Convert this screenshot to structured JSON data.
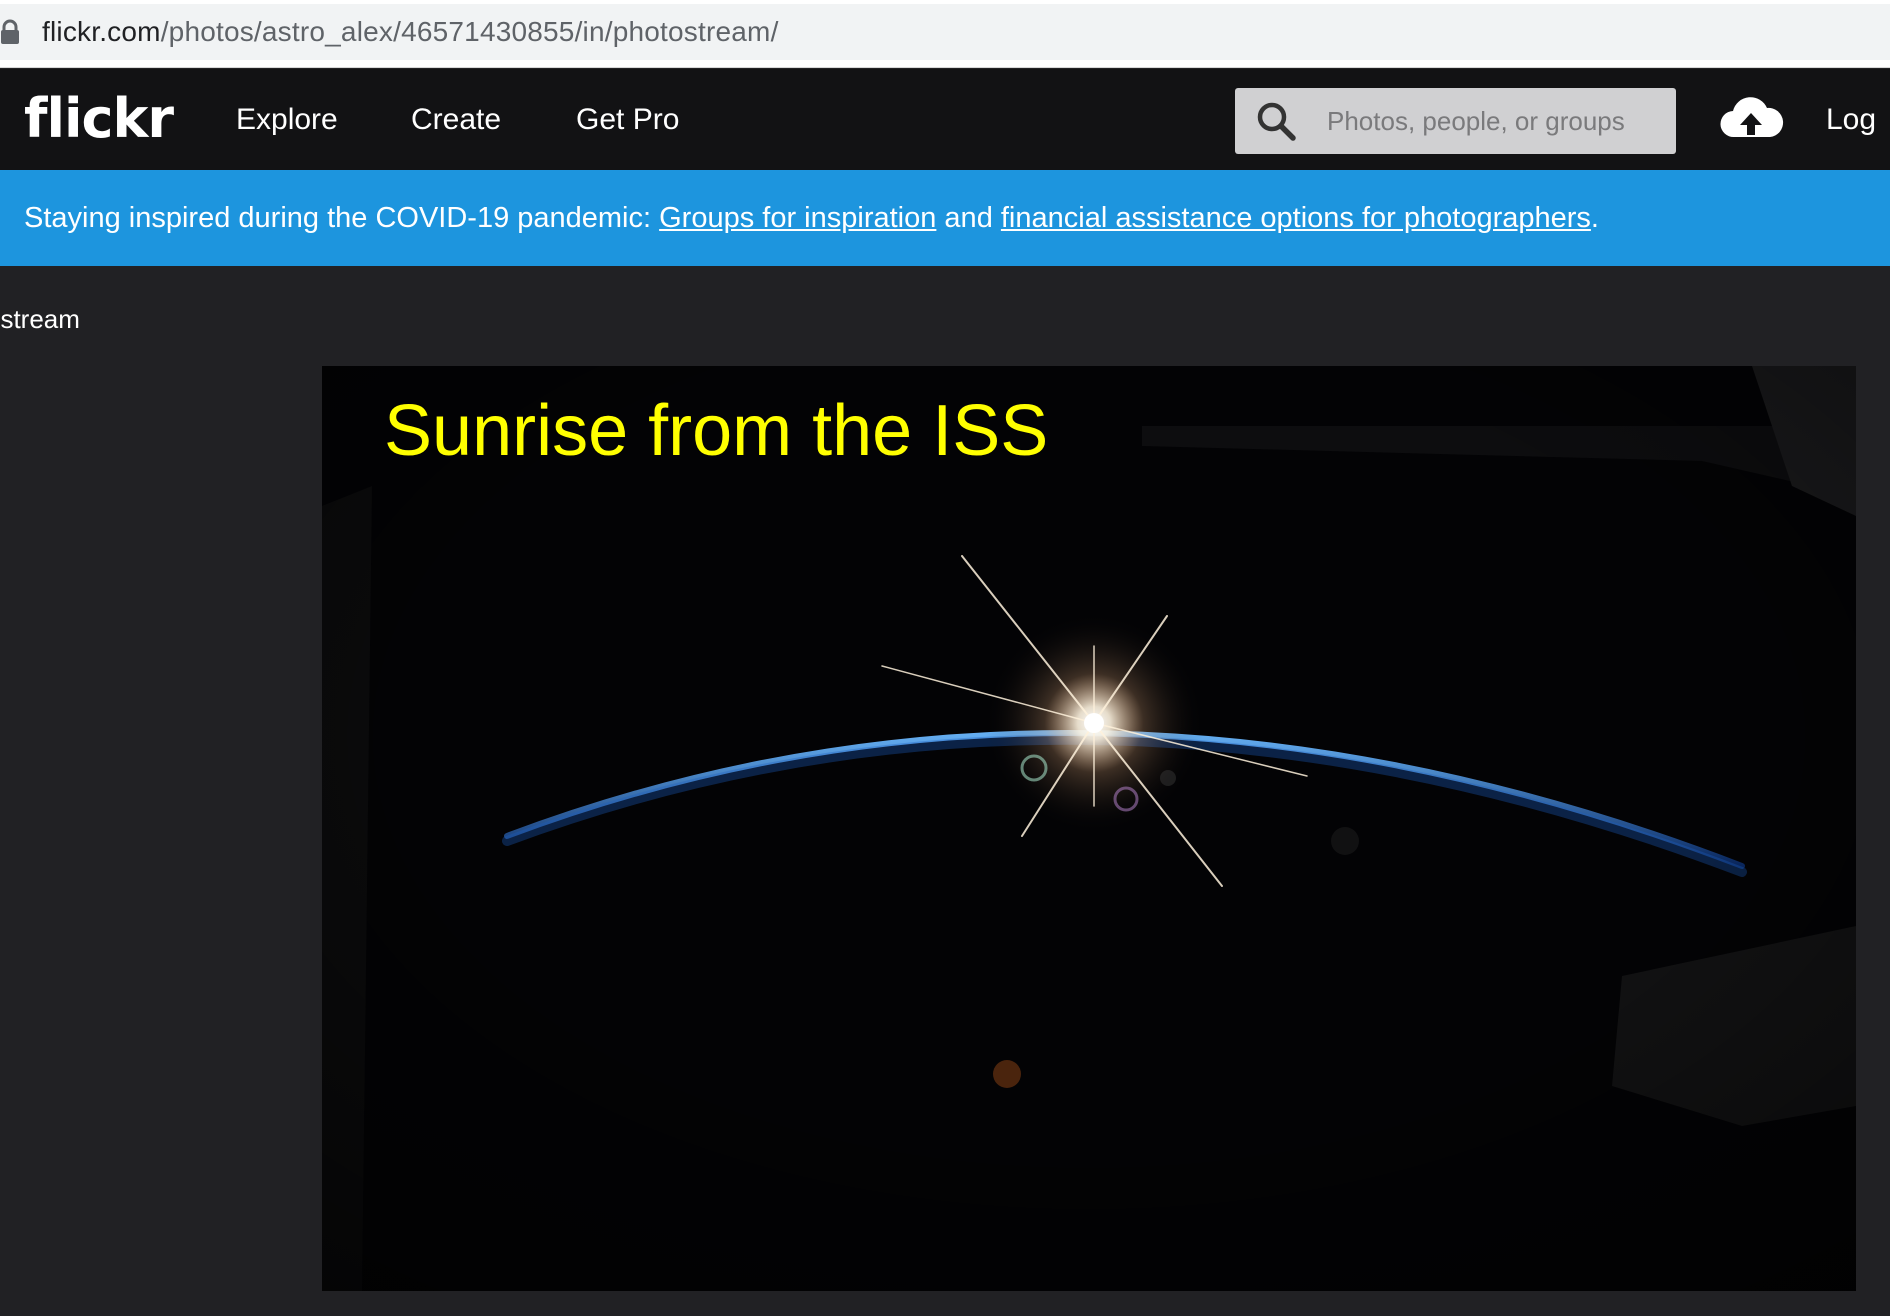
{
  "browser": {
    "url_host": "flickr.com",
    "url_path": "/photos/astro_alex/46571430855/in/photostream/"
  },
  "navbar": {
    "logo": "flickr",
    "links": [
      "Explore",
      "Create",
      "Get Pro"
    ],
    "search_placeholder": "Photos, people, or groups",
    "login_label": "Log"
  },
  "banner": {
    "text_prefix": "Staying inspired during the COVID-19 pandemic: ",
    "link1": "Groups for inspiration",
    "text_middle": " and ",
    "link2": "financial assistance options for photographers",
    "text_suffix": "."
  },
  "page": {
    "back_link": "ostream"
  },
  "photo": {
    "caption": "Sunrise from the ISS",
    "caption_color": "#ffff00",
    "description": "sunrise-earth-horizon"
  },
  "colors": {
    "navbar_bg": "#121214",
    "banner_bg": "#1d95de",
    "page_bg": "#212124"
  }
}
